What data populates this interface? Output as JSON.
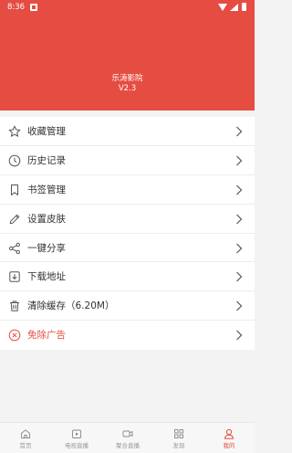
{
  "status_bar": {
    "time": "8:36"
  },
  "header": {
    "app_name": "乐涛影院",
    "version": "V2.3"
  },
  "menu": [
    {
      "label": "收藏管理",
      "icon": "star-icon"
    },
    {
      "label": "历史记录",
      "icon": "clock-icon"
    },
    {
      "label": "书签管理",
      "icon": "bookmark-icon"
    },
    {
      "label": "设置皮肤",
      "icon": "pencil-icon"
    },
    {
      "label": "一键分享",
      "icon": "share-icon"
    },
    {
      "label": "下载地址",
      "icon": "download-icon"
    },
    {
      "label": "清除缓存（6.20M）",
      "icon": "trash-icon"
    },
    {
      "label": "免除广告",
      "icon": "close-circle-icon"
    }
  ],
  "tabs": [
    {
      "label": "首页",
      "icon": "home-icon"
    },
    {
      "label": "电视直播",
      "icon": "tv-icon"
    },
    {
      "label": "聚合直播",
      "icon": "video-camera-icon"
    },
    {
      "label": "发现",
      "icon": "grid-icon"
    },
    {
      "label": "我的",
      "icon": "person-icon"
    }
  ],
  "colors": {
    "accent": "#e54d42",
    "text": "#333333",
    "muted": "#999999",
    "background": "#f3f3f3"
  }
}
